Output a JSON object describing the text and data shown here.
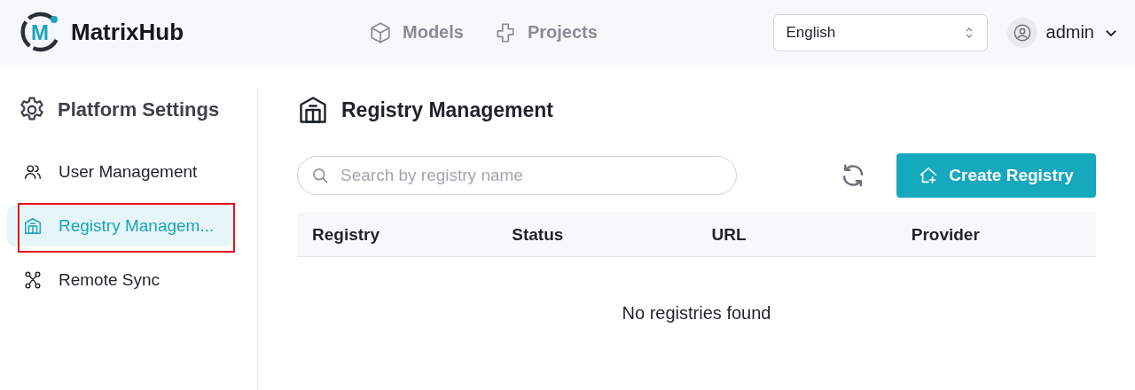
{
  "header": {
    "logo_letter": "M",
    "brand": "MatrixHub",
    "nav": [
      {
        "label": "Models",
        "kind": "cube",
        "selected": false
      },
      {
        "label": "Projects",
        "kind": "puzzle",
        "selected": false
      }
    ],
    "language": {
      "value": "English"
    },
    "user": {
      "name": "admin"
    }
  },
  "sidebar": {
    "title": "Platform Settings",
    "items": [
      {
        "label": "User Management",
        "kind": "users",
        "selected": false,
        "annotated": false
      },
      {
        "label": "Registry Managem...",
        "kind": "registry",
        "selected": true,
        "annotated": true
      },
      {
        "label": "Remote Sync",
        "kind": "sync",
        "selected": false,
        "annotated": false
      }
    ]
  },
  "main": {
    "title": "Registry Management",
    "search": {
      "placeholder": "Search by registry name"
    },
    "create_button": "Create Registry",
    "table": {
      "columns": [
        "Registry",
        "Status",
        "URL",
        "Provider"
      ],
      "empty_message": "No registries found"
    }
  }
}
